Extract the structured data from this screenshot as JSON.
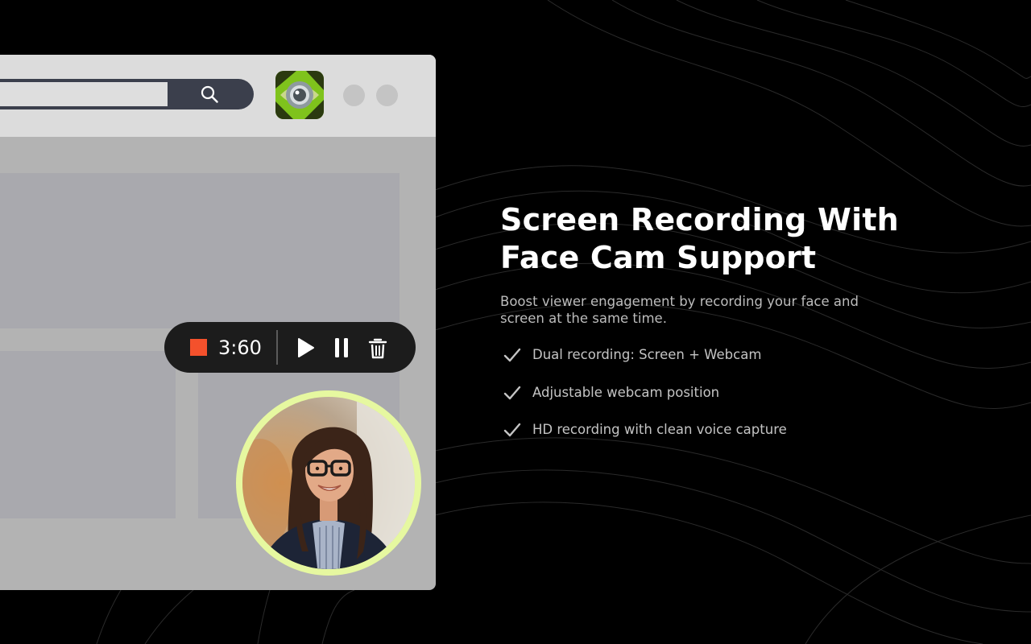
{
  "headline": "Screen Recording With Face Cam Support",
  "headline_lines": [
    "Screen Recording With",
    "Face Cam Support"
  ],
  "subtitle": "Boost viewer engagement by recording your face and screen at the same time.",
  "features": [
    {
      "icon": "check-icon",
      "text": "Dual recording: Screen + Webcam"
    },
    {
      "icon": "check-icon",
      "text": "Adjustable webcam position"
    },
    {
      "icon": "check-icon",
      "text": "HD recording with clean voice capture"
    }
  ],
  "recorder": {
    "timer": "3:60",
    "stop_icon": "stop-square-icon",
    "play_icon": "play-icon",
    "pause_icon": "pause-icon",
    "delete_icon": "trash-icon"
  },
  "browser": {
    "search_icon": "search-icon",
    "app_icon": "camera-lens-icon"
  },
  "colors": {
    "background": "#000000",
    "browser_frame": "#b3b3b3",
    "browser_toolbar": "#dcdcdc",
    "search_bar": "#3b3f4c",
    "controls_bg": "#1c1c1c",
    "stop_red": "#f4512c",
    "webcam_ring": "#e6f8a0",
    "app_icon_green": "#7fc31c"
  }
}
